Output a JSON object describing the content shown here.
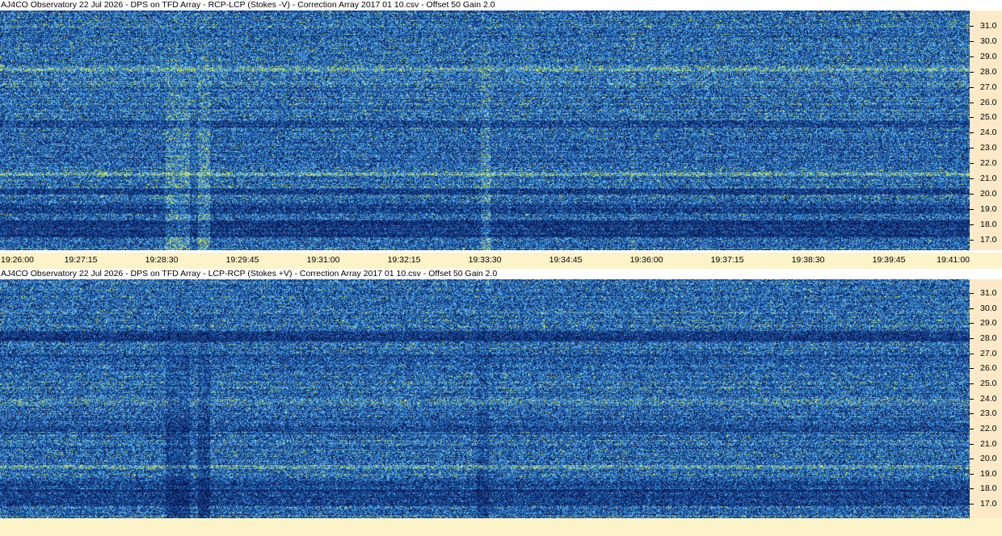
{
  "panels": [
    {
      "id": "top",
      "title": "AJ4CO Observatory 22 Jul 2026  -  DPS on TFD Array  -  RCP-LCP (Stokes -V)  -  Correction Array 2017 01 10.csv  -  Offset 50  Gain 2.0",
      "y_ticks": [
        "31.0",
        "30.0",
        "29.0",
        "28.0",
        "27.0",
        "26.0",
        "25.0",
        "24.0",
        "23.0",
        "22.0",
        "21.0",
        "20.0",
        "19.0",
        "18.0",
        "17.0"
      ]
    },
    {
      "id": "bottom",
      "title": "AJ4CO Observatory 22 Jul 2026  -  DPS on TFD Array  -  LCP-RCP (Stokes +V)  -  Correction Array 2017 01 10.csv  -  Offset 50  Gain 2.0",
      "y_ticks": [
        "31.0",
        "30.0",
        "29.0",
        "28.0",
        "27.0",
        "26.0",
        "25.0",
        "24.0",
        "23.0",
        "22.0",
        "21.0",
        "20.0",
        "19.0",
        "18.0",
        "17.0"
      ]
    }
  ],
  "x_axis": {
    "labels": [
      "19:26:00",
      "19:27:15",
      "19:28:30",
      "19:29:45",
      "19:31:00",
      "19:32:15",
      "19:33:30",
      "19:34:45",
      "19:36:00",
      "19:37:15",
      "19:38:30",
      "19:39:45",
      "19:41:00"
    ]
  },
  "colors": {
    "axis_bg": "#fde9c7",
    "strip_bg": "#fdf3c8",
    "spectrogram_base": "#1e5aa8",
    "spectrogram_dark": "#0a1a55",
    "spectrogram_light": "#59b6f0",
    "spectrogram_hot": "#d6e85a"
  }
}
